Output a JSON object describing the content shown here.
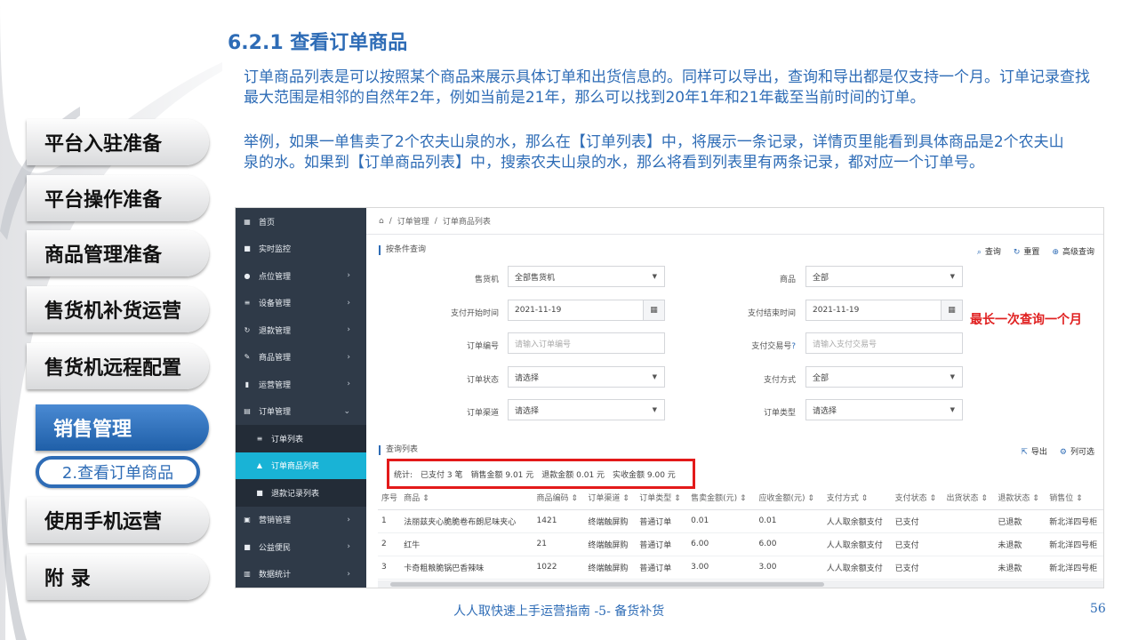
{
  "slide": {
    "title": "6.2.1 查看订单商品",
    "paragraph1": "订单商品列表是可以按照某个商品来展示具体订单和出货信息的。同样可以导出，查询和导出都是仅支持一个月。订单记录查找最大范围是相邻的自然年2年，例如当前是21年，那么可以找到20年1年和21年截至当前时间的订单。",
    "paragraph2": "举例，如果一单售卖了2个农夫山泉的水，那么在【订单列表】中，将展示一条记录，详情页里能看到具体商品是2个农夫山泉的水。如果到【订单商品列表】中，搜索农夫山泉的水，那么将看到列表里有两条记录，都对应一个订单号。",
    "footer": "人人取快速上手运营指南 -5- 备货补货",
    "page_number": "56"
  },
  "left_nav": {
    "items": [
      "平台入驻准备",
      "平台操作准备",
      "商品管理准备",
      "售货机补货运营",
      "售货机远程配置",
      "销售管理",
      "使用手机运营",
      "附 录"
    ],
    "active_index": 5,
    "sub_item": "2.查看订单商品",
    "accent_color": "#2e6cb6"
  },
  "app": {
    "sidebar": [
      {
        "label": "首页",
        "icon": "dashboard-icon",
        "glyph": "▦",
        "chevron": ""
      },
      {
        "label": "实时监控",
        "icon": "camera-icon",
        "glyph": "■",
        "chevron": ""
      },
      {
        "label": "点位管理",
        "icon": "map-pin-icon",
        "glyph": "●",
        "chevron": "›"
      },
      {
        "label": "设备管理",
        "icon": "sort-icon",
        "glyph": "≡",
        "chevron": "›"
      },
      {
        "label": "退款管理",
        "icon": "refresh-icon",
        "glyph": "↻",
        "chevron": "›"
      },
      {
        "label": "商品管理",
        "icon": "edit-icon",
        "glyph": "✎",
        "chevron": "›"
      },
      {
        "label": "运营管理",
        "icon": "bookmark-icon",
        "glyph": "▮",
        "chevron": "›"
      },
      {
        "label": "订单管理",
        "icon": "table-icon",
        "glyph": "▤",
        "chevron": "⌄"
      }
    ],
    "sidebar_sub": [
      {
        "label": "订单列表",
        "icon": "list-icon",
        "glyph": "≡"
      },
      {
        "label": "订单商品列表",
        "icon": "sitemap-icon",
        "glyph": "▲"
      },
      {
        "label": "退款记录列表",
        "icon": "square-icon",
        "glyph": "■"
      }
    ],
    "sidebar_after": [
      {
        "label": "营销管理",
        "icon": "gift-icon",
        "glyph": "▣",
        "chevron": "›"
      },
      {
        "label": "公益便民",
        "icon": "square-icon",
        "glyph": "■",
        "chevron": "›"
      },
      {
        "label": "数据统计",
        "icon": "chart-icon",
        "glyph": "▥",
        "chevron": "›"
      }
    ],
    "breadcrumb": [
      "订单管理",
      "订单商品列表"
    ],
    "filter_title": "按条件查询",
    "filter_buttons": {
      "search": "查询",
      "reset": "重置",
      "advanced": "高级查询"
    },
    "filters": {
      "machine_label": "售货机",
      "machine_value": "全部售货机",
      "product_label": "商品",
      "product_value": "全部",
      "pay_start_label": "支付开始时间",
      "pay_start_value": "2021-11-19",
      "pay_end_label": "支付结束时间",
      "pay_end_value": "2021-11-19",
      "order_no_label": "订单编号",
      "order_no_placeholder": "请输入订单编号",
      "trade_no_label": "支付交易号",
      "trade_no_placeholder": "请输入支付交易号",
      "order_status_label": "订单状态",
      "order_status_value": "请选择",
      "pay_method_label": "支付方式",
      "pay_method_value": "全部",
      "channel_label": "订单渠道",
      "channel_value": "请选择",
      "order_type_label": "订单类型",
      "order_type_value": "请选择"
    },
    "annotation": "最长一次查询一个月",
    "list_title": "查询列表",
    "list_buttons": {
      "export": "导出",
      "columns": "列可选"
    },
    "stats": {
      "label": "统计:",
      "paid": "已支付 3 笔",
      "sales": "销售金额 9.01 元",
      "refund": "退款金额 0.01 元",
      "received": "实收金额 9.00 元"
    },
    "table": {
      "headers": [
        "序号",
        "商品 ⇕",
        "商品编码 ⇕",
        "订单渠道 ⇕",
        "订单类型 ⇕",
        "售卖金额(元) ⇕",
        "应收金额(元) ⇕",
        "支付方式 ⇕",
        "支付状态 ⇕",
        "出货状态 ⇕",
        "退款状态 ⇕",
        "销售位 ⇕"
      ],
      "rows": [
        [
          "1",
          "法丽兹夹心脆脆卷布朗尼味夹心",
          "1421",
          "终端触屏购",
          "普通订单",
          "0.01",
          "0.01",
          "人人取余额支付",
          "已支付",
          "",
          "已退款",
          "新北洋四号柜"
        ],
        [
          "2",
          "红牛",
          "21",
          "终端触屏购",
          "普通订单",
          "6.00",
          "6.00",
          "人人取余额支付",
          "已支付",
          "",
          "未退款",
          "新北洋四号柜"
        ],
        [
          "3",
          "卡奇粗粮脆锅巴香辣味",
          "1022",
          "终端触屏购",
          "普通订单",
          "3.00",
          "3.00",
          "人人取余额支付",
          "已支付",
          "",
          "未退款",
          "新北洋四号柜"
        ]
      ]
    }
  }
}
